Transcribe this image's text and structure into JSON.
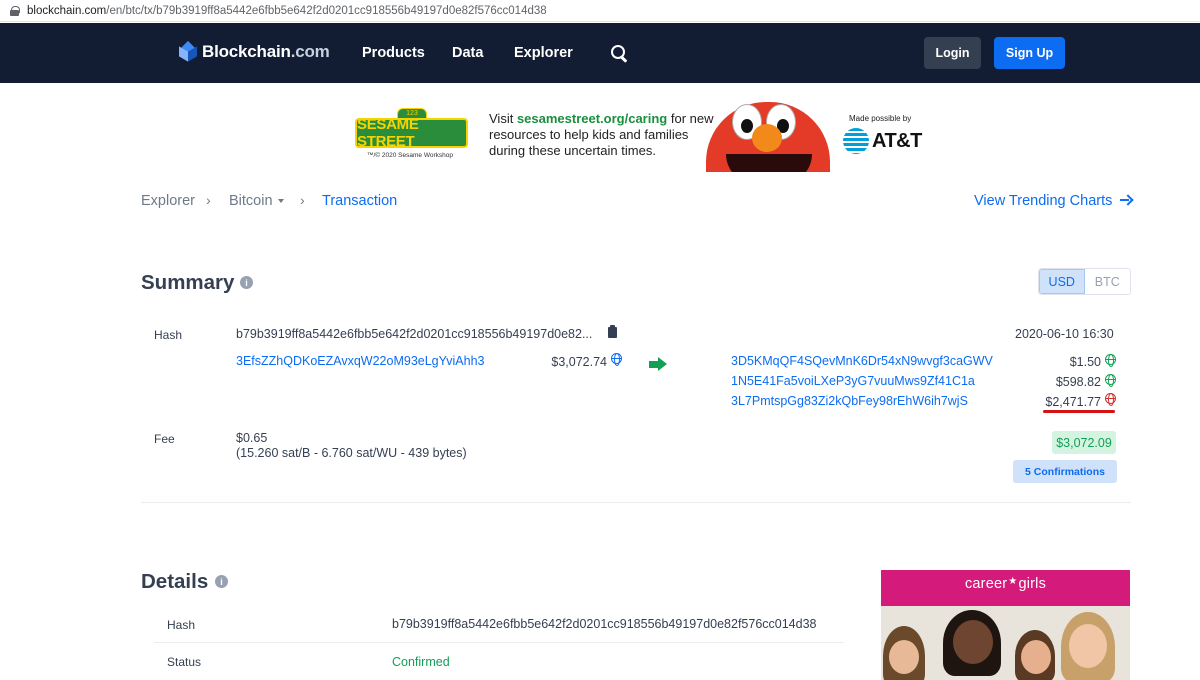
{
  "browser": {
    "url_domain": "blockchain.com",
    "url_path": "/en/btc/tx/b79b3919ff8a5442e6fbb5e642f2d0201cc918556b49197d0e82f576cc014d38"
  },
  "nav": {
    "brand": "Blockchain",
    "brand_suffix": ".com",
    "links": [
      "Products",
      "Data",
      "Explorer"
    ],
    "login": "Login",
    "signup": "Sign Up"
  },
  "ad_banner": {
    "logo_top": "123",
    "logo": "SESAME STREET",
    "copyright": "™/© 2020 Sesame Workshop",
    "text_before": "Visit ",
    "link": "sesamestreet.org/caring",
    "text_after": " for new resources to help kids and families during these uncertain times.",
    "made_possible": "Made possible by",
    "sponsor": "AT&T"
  },
  "breadcrumb": {
    "items": [
      "Explorer",
      "Bitcoin",
      "Transaction"
    ],
    "trending": "View Trending Charts"
  },
  "summary": {
    "title": "Summary",
    "currency_options": [
      "USD",
      "BTC"
    ],
    "selected_currency": "USD",
    "hash_label": "Hash",
    "hash_short": "b79b3919ff8a5442e6fbb5e642f2d0201cc918556b49197d0e82...",
    "timestamp": "2020-06-10 16:30",
    "input": {
      "address": "3EfsZZhQDKoEZAvxqW22oM93eLgYviAhh3",
      "amount": "$3,072.74"
    },
    "outputs": [
      {
        "address": "3D5KMqQF4SQevMnK6Dr54xN9wvgf3caGWV",
        "amount": "$1.50",
        "status_color": "#12a055"
      },
      {
        "address": "1N5E41Fa5voiLXeP3yG7vuuMws9Zf41C1a",
        "amount": "$598.82",
        "status_color": "#12a055"
      },
      {
        "address": "3L7PmtspGg83Zi2kQbFey98rEhW6ih7wjS",
        "amount": "$2,471.77",
        "status_color": "#d0312d"
      }
    ],
    "fee_label": "Fee",
    "fee_value": "$0.65",
    "fee_detail": "(15.260 sat/B - 6.760 sat/WU - 439 bytes)",
    "total": "$3,072.09",
    "confirmations": "5 Confirmations"
  },
  "details": {
    "title": "Details",
    "rows": [
      {
        "label": "Hash",
        "value": "b79b3919ff8a5442e6fbb5e642f2d0201cc918556b49197d0e82f576cc014d38"
      },
      {
        "label": "Status",
        "value": "Confirmed"
      }
    ]
  },
  "side_ad": {
    "brand_left": "career",
    "brand_right": "girls"
  },
  "colors": {
    "nav_bg": "#121d33",
    "accent": "#0c6cf2",
    "success": "#12a055",
    "danger": "#d0312d"
  }
}
